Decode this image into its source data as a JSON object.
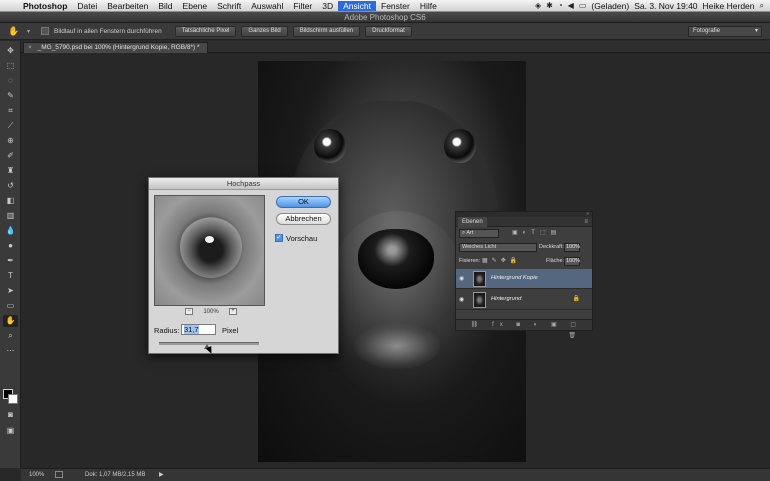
{
  "menubar": {
    "apple": "",
    "items": [
      "Photoshop",
      "Datei",
      "Bearbeiten",
      "Bild",
      "Ebene",
      "Schrift",
      "Auswahl",
      "Filter",
      "3D",
      "Ansicht",
      "Fenster",
      "Hilfe"
    ],
    "battery": "(Geladen)",
    "datetime": "Sa. 3. Nov 19:40",
    "user": "Heike Herden"
  },
  "app": {
    "title": "Adobe Photoshop CS6"
  },
  "options": {
    "scroll_all_label": "Bildlauf in allen Fenstern durchführen",
    "buttons": [
      "Tatsächliche Pixel",
      "Ganzes Bild",
      "Bildschirm ausfüllen",
      "Druckformat"
    ],
    "workspace": "Fotografie"
  },
  "document": {
    "tab_label": "_MG_5790.psd bei 100% (Hintergrund Kopie, RGB/8*) *",
    "tab_close": "×"
  },
  "dialog": {
    "title": "Hochpass",
    "ok_label": "OK",
    "cancel_label": "Abbrechen",
    "preview_label": "Vorschau",
    "preview_checked": true,
    "zoom_out": "−",
    "zoom_in": "+",
    "zoom_level": "100%",
    "radius_label": "Radius:",
    "radius_value": "31,7",
    "radius_unit": "Pixel"
  },
  "layers_panel": {
    "tab": "Ebenen",
    "filter_kind": "Art",
    "blend_mode": "Weiches Licht",
    "opacity_label": "Deckkraft:",
    "opacity_value": "100%",
    "lock_label": "Fixieren:",
    "fill_label": "Fläche:",
    "fill_value": "100%",
    "layers": [
      {
        "name": "Hintergrund Kopie",
        "selected": true
      },
      {
        "name": "Hintergrund",
        "selected": false
      }
    ]
  },
  "status": {
    "zoom": "100%",
    "doc_info": "Dok: 1,07 MB/2,15 MB"
  },
  "icons": {
    "tools": [
      "move-icon",
      "marquee-icon",
      "lasso-icon",
      "quick-select-icon",
      "crop-icon",
      "eyedropper-icon",
      "healing-icon",
      "brush-icon",
      "stamp-icon",
      "history-brush-icon",
      "eraser-icon",
      "gradient-icon",
      "blur-icon",
      "dodge-icon",
      "pen-icon",
      "type-icon",
      "path-select-icon",
      "rectangle-icon",
      "hand-icon",
      "zoom-icon"
    ]
  },
  "colors": {
    "accent_blue": "#4e94e6",
    "selected_layer": "#55667f"
  }
}
